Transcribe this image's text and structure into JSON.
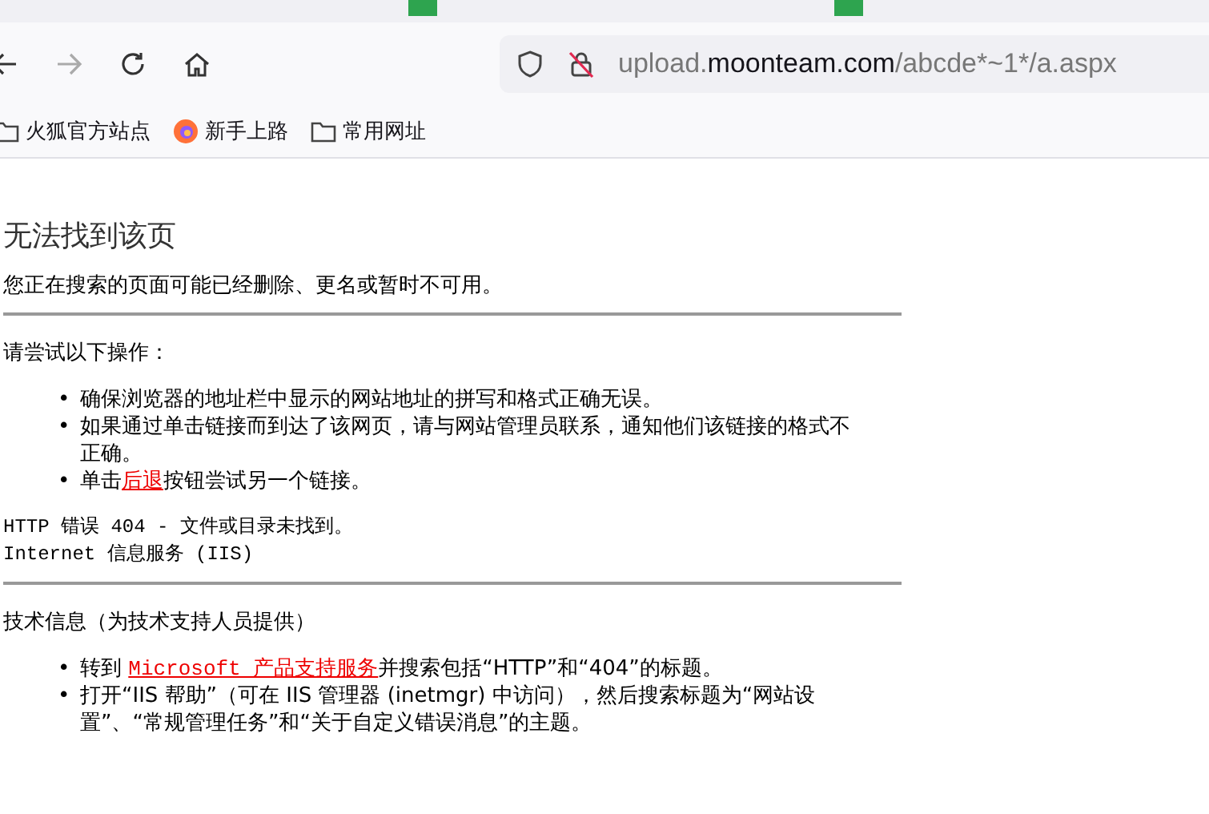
{
  "address_bar": {
    "url_host_prefix": "upload.",
    "url_domain": "moonteam.com",
    "url_path": "/abcde*~1*/a.aspx"
  },
  "bookmarks": [
    {
      "kind": "folder",
      "label": "火狐官方站点"
    },
    {
      "kind": "firefox",
      "label": "新手上路"
    },
    {
      "kind": "folder",
      "label": "常用网址"
    }
  ],
  "page": {
    "title": "无法找到该页",
    "subtitle": "您正在搜索的页面可能已经删除、更名或暂时不可用。",
    "try_heading": "请尝试以下操作：",
    "try_items": [
      {
        "bullet": "•",
        "before": "确保浏览器的地址栏中显示的网站地址的拼写和格式正确无误。"
      },
      {
        "bullet": "•",
        "before": "如果通过单击链接而到达了该网页，请与网站管理员联系，通知他们该链接的格式不正确。"
      },
      {
        "bullet": "•",
        "before": "单击",
        "link": "后退",
        "after": "按钮尝试另一个链接。"
      }
    ],
    "error_line": "HTTP 错误 404 - 文件或目录未找到。",
    "server_line": "Internet 信息服务 (IIS)",
    "tech_heading": "技术信息（为技术支持人员提供）",
    "tech_items": [
      {
        "bullet": "•",
        "before": "转到 ",
        "link": "Microsoft 产品支持服务",
        "after": "并搜索包括“HTTP”和“404”的标题。"
      },
      {
        "bullet": "•",
        "before": "打开“IIS 帮助”（可在 IIS 管理器 (inetmgr) 中访问），然后搜索标题为“网站设置”、“常规管理任务”和“关于自定义错误消息”的主题。"
      }
    ]
  }
}
